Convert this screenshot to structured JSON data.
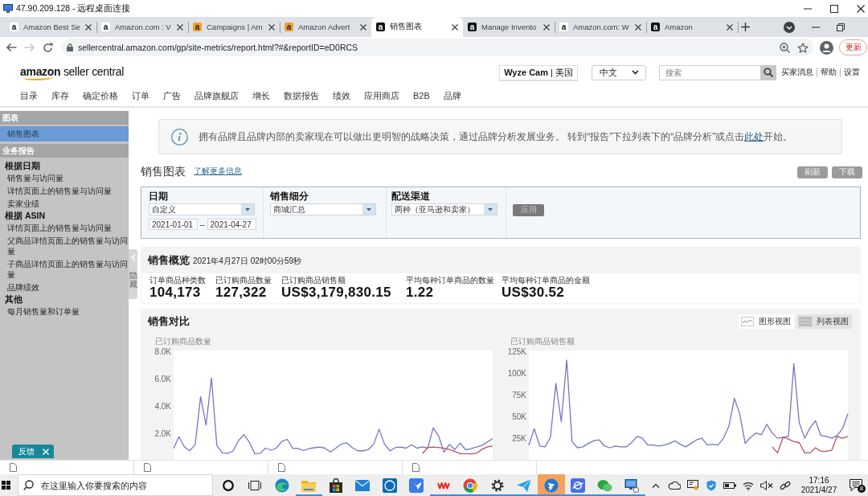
{
  "remote_window": {
    "title": "47.90.209.128 - 远程桌面连接"
  },
  "browser": {
    "tabs": [
      {
        "favicon": "a",
        "kind": "plain",
        "title": "Amazon Best Se",
        "selected": false
      },
      {
        "favicon": "a",
        "kind": "plain",
        "title": "Amazon.com : V",
        "selected": false
      },
      {
        "favicon": "a",
        "kind": "orange",
        "title": "Campaigns | Am",
        "selected": false
      },
      {
        "favicon": "a",
        "kind": "orange",
        "title": "Amazon Advert",
        "selected": false
      },
      {
        "favicon": "a",
        "kind": "dark",
        "title": "销售图表",
        "selected": true
      },
      {
        "favicon": "a",
        "kind": "dark",
        "title": "Manage Invento",
        "selected": false
      },
      {
        "favicon": "a",
        "kind": "plain",
        "title": "Amazon.com: W",
        "selected": false
      },
      {
        "favicon": "a",
        "kind": "dark",
        "title": "Amazon",
        "selected": false
      }
    ],
    "navigation": [
      {
        "kind": "back",
        "disabled": false
      },
      {
        "kind": "forward",
        "disabled": true
      },
      {
        "kind": "reload",
        "disabled": false
      }
    ],
    "address": "sellercentral.amazon.com/gp/site-metrics/report.html?#&reportID=eD0RCS",
    "update_button": "更新"
  },
  "header": {
    "logo": "**amazon** seller central",
    "account": "**Wyze Cam** | 美国",
    "language": "中文",
    "search": {
      "placeholder": "搜索"
    },
    "links": [
      "买家消息",
      "帮助",
      "设置"
    ],
    "nav": [
      "目录",
      "库存",
      "确定价格",
      "订单",
      "广告",
      "品牌旗舰店",
      "增长",
      "数据报告",
      "绩效",
      "应用商店",
      "B2B",
      "品牌"
    ]
  },
  "sidebar": {
    "sections": [
      {
        "title": "图表",
        "groups": [
          {
            "items": [
              {
                "label": "销售图表",
                "selected": true
              }
            ]
          }
        ]
      },
      {
        "title": "业务报告",
        "groups": [
          {
            "title": "根据日期",
            "items": [
              {
                "label": "销售量与访问量",
                "selected": false
              },
              {
                "label": "详情页面上的销售量与访问量",
                "selected": false
              },
              {
                "label": "卖家业绩",
                "selected": false
              }
            ]
          },
          {
            "title": "根据 ASIN",
            "items": [
              {
                "label": "详情页面上的销售量与访问量",
                "selected": false
              },
              {
                "label": "父商品详情页面上的销售量与访问量",
                "selected": false
              },
              {
                "label": "子商品详情页面上的销售量与访问量",
                "selected": false
              },
              {
                "label": "品牌绩效",
                "selected": false
              }
            ]
          },
          {
            "title": "其他",
            "items": [
              {
                "label": "每月销售量和订单量",
                "selected": false
              }
            ]
          }
        ]
      }
    ],
    "toggle": "隐藏"
  },
  "feedback": {
    "label": "反馈"
  },
  "notice": {
    "text": "拥有品牌且品牌内部的卖家现在可以做出更明智的战略决策，通过品牌分析发展业务。 转到“报告”下拉列表下的“品牌分析”或点击",
    "link": "此处",
    "after": "开始。"
  },
  "report": {
    "title": "销售图表",
    "learn_more": "了解更多信息",
    "actions": [
      "刷新",
      "下载"
    ]
  },
  "filters": {
    "fields": [
      {
        "label": "日期",
        "kind": "daterange",
        "value": "自定义",
        "from": "2021-01-01",
        "separator": "–",
        "to": "2021-04-27"
      },
      {
        "label": "销售细分",
        "kind": "select",
        "value": "商城汇总"
      },
      {
        "label": "配送渠道",
        "kind": "select",
        "value": "两种（亚马逊和卖家）"
      }
    ],
    "apply": {
      "label": "应用",
      "disabled": true
    }
  },
  "overview": {
    "title": "销售概览",
    "timestamp": "2021年4月27日 02时00分59秒",
    "metrics": [
      {
        "label": "订单商品种类数",
        "value": "104,173"
      },
      {
        "label": "已订购商品数量",
        "value": "127,322"
      },
      {
        "label": "已订购商品销售额",
        "value": "US$3,179,830.15"
      },
      {
        "label": "平均每种订单商品的数量",
        "value": "1.22"
      },
      {
        "label": "平均每种订单商品的金额",
        "value": "US$30.52"
      }
    ]
  },
  "comparison": {
    "title": "销售对比",
    "views": [
      {
        "label": "图形视图",
        "kind": "graph",
        "selected": true
      },
      {
        "label": "列表视图",
        "kind": "table",
        "selected": false
      }
    ],
    "charts": [
      {
        "chart_data": {
          "type": "line",
          "title": "已订购商品数量",
          "categories": [
            null,
            null,
            null,
            null,
            null,
            null,
            null,
            null,
            null,
            null,
            null,
            null,
            null,
            null,
            null,
            null,
            null,
            null,
            null,
            null,
            null,
            null,
            null,
            null,
            null,
            null,
            null,
            null,
            null,
            null,
            null,
            null,
            null,
            null,
            null,
            null,
            null,
            null,
            null,
            null,
            null,
            null,
            null,
            null,
            null,
            null,
            null,
            null,
            null,
            null,
            null,
            null,
            null,
            null,
            null,
            null,
            null,
            null,
            null,
            null
          ],
          "ylim": [
            0,
            8000
          ],
          "yticks": [
            {
              "value": 2000,
              "label": "2.0K"
            },
            {
              "value": 4000,
              "label": "4.0K"
            },
            {
              "value": 6000,
              "label": "6.0K"
            },
            {
              "value": 8000,
              "label": "8.0K"
            }
          ],
          "series": [
            {
              "color": "#7676c4",
              "values": [
                780,
                1650,
                890,
                610,
                1080,
                4600,
                2500,
                6000,
                1000,
                450,
                420,
                590,
                1350,
                1800,
                1250,
                400,
                420,
                800,
                650,
                800,
                1300,
                1450,
                800,
                780,
                620,
                760,
                830,
                880,
                800,
                520,
                800,
                1100,
                1200,
                850,
                620,
                590,
                700,
                1100,
                2200,
                1100,
                600,
                850,
                880,
                800,
                1050,
                800,
                900,
                800,
                2300,
                1700,
                500,
                1080,
                700,
                1180,
                680,
                760,
                880,
                1000,
                1250,
                1500
              ]
            },
            {
              "color": "#b5545a",
              "values": [
                null,
                null,
                null,
                null,
                null,
                null,
                null,
                null,
                null,
                null,
                null,
                null,
                null,
                null,
                null,
                null,
                null,
                null,
                null,
                null,
                null,
                null,
                null,
                null,
                null,
                null,
                null,
                null,
                null,
                null,
                null,
                null,
                null,
                null,
                null,
                null,
                null,
                null,
                null,
                null,
                null,
                null,
                null,
                null,
                null,
                null,
                400,
                850,
                880,
                850,
                790,
                700,
                550,
                400,
                400,
                380,
                420,
                700,
                900,
                960
              ]
            }
          ]
        }
      },
      {
        "chart_data": {
          "type": "line",
          "title": "已订购商品销售额",
          "categories": [
            null,
            null,
            null,
            null,
            null,
            null,
            null,
            null,
            null,
            null,
            null,
            null,
            null,
            null,
            null,
            null,
            null,
            null,
            null,
            null,
            null,
            null,
            null,
            null,
            null,
            null,
            null,
            null,
            null,
            null,
            null,
            null,
            null,
            null,
            null,
            null,
            null,
            null,
            null,
            null,
            null,
            null,
            null,
            null,
            null,
            null,
            null,
            null,
            null,
            null,
            null,
            null,
            null,
            null,
            null,
            null,
            null,
            null,
            null,
            null
          ],
          "ylim": [
            0,
            125000
          ],
          "yticks": [
            {
              "value": 25000,
              "label": "25K"
            },
            {
              "value": 50000,
              "label": "50K"
            },
            {
              "value": 75000,
              "label": "75K"
            },
            {
              "value": 100000,
              "label": "100K"
            },
            {
              "value": 125000,
              "label": "125K"
            }
          ],
          "series": [
            {
              "color": "#7676c4",
              "values": [
                16000,
                35000,
                15000,
                14000,
                25000,
                87000,
                43000,
                114000,
                20000,
                13000,
                14000,
                18000,
                21000,
                22000,
                15000,
                13000,
                15000,
                14000,
                14000,
                19000,
                26000,
                24000,
                16000,
                16000,
                15000,
                16000,
                18000,
                21000,
                17000,
                14000,
                18000,
                22000,
                24000,
                16000,
                17000,
                16000,
                24000,
                38000,
                70000,
                52000,
                18000,
                25000,
                30000,
                28000,
                40000,
                30000,
                24000,
                25000,
                26000,
                110000,
                42000,
                24000,
                36000,
                44000,
                27000,
                26000,
                24000,
                27000,
                35000,
                52000
              ]
            },
            {
              "color": "#b5545a",
              "values": [
                null,
                null,
                null,
                null,
                null,
                null,
                null,
                null,
                null,
                null,
                null,
                null,
                null,
                null,
                null,
                null,
                null,
                null,
                null,
                null,
                null,
                null,
                null,
                null,
                null,
                null,
                null,
                null,
                null,
                null,
                null,
                null,
                null,
                null,
                null,
                null,
                null,
                null,
                null,
                null,
                null,
                null,
                null,
                null,
                null,
                14000,
                7000,
                25000,
                23000,
                20000,
                19000,
                7000,
                7000,
                13000,
                9000,
                9000,
                10000,
                26000,
                24000,
                26000
              ]
            }
          ]
        }
      }
    ]
  },
  "taskbar": {
    "search": {
      "placeholder": "在这里输入你要搜索的内容"
    },
    "apps": [
      {
        "kind": "swirl",
        "running": false,
        "selected": false
      },
      {
        "kind": "folder",
        "running": true,
        "selected": false
      },
      {
        "kind": "bag",
        "running": false,
        "selected": false
      },
      {
        "kind": "mail",
        "running": false,
        "selected": false
      },
      {
        "kind": "tile",
        "running": false,
        "selected": false
      },
      {
        "kind": "check",
        "running": false,
        "selected": false
      },
      {
        "kind": "zigzag",
        "running": true,
        "selected": false
      },
      {
        "kind": "wheel",
        "running": true,
        "selected": false
      },
      {
        "kind": "gear",
        "running": true,
        "selected": false
      },
      {
        "kind": "plane",
        "running": true,
        "selected": false
      },
      {
        "kind": "bolt",
        "running": true,
        "selected": true
      },
      {
        "kind": "planet",
        "running": true,
        "selected": false
      },
      {
        "kind": "bubbles",
        "running": true,
        "selected": false
      },
      {
        "kind": "monitor",
        "running": true,
        "selected": false
      }
    ],
    "clock": {
      "time": "17:16",
      "date": "2021/4/27"
    },
    "notification_count": "8"
  }
}
